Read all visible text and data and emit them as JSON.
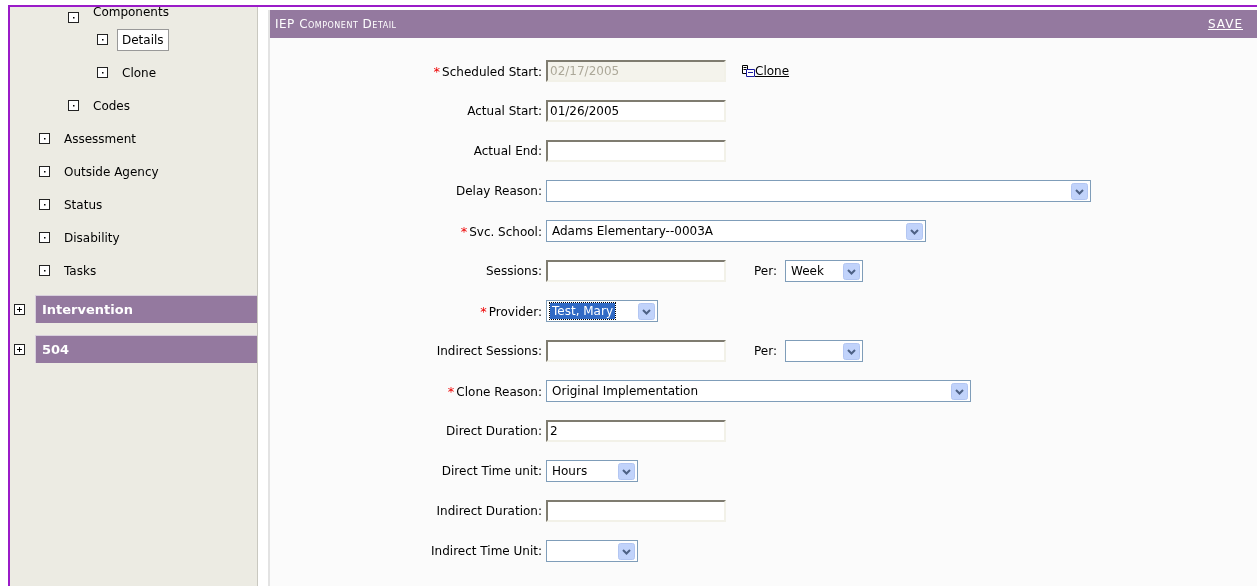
{
  "sidebar": {
    "items": [
      {
        "children": [
          {
            "label": "Components",
            "children": [
              {
                "label": "Details",
                "selected": true
              },
              {
                "label": "Clone",
                "selected": false
              }
            ]
          },
          {
            "label": "Codes",
            "selected": false
          }
        ]
      },
      {
        "label": "Assessment",
        "selected": false
      },
      {
        "label": "Outside Agency",
        "selected": false
      },
      {
        "label": "Status",
        "selected": false
      },
      {
        "label": "Disability",
        "selected": false
      },
      {
        "label": "Tasks",
        "selected": false
      }
    ],
    "sections": [
      {
        "label": "Intervention",
        "expanded": false
      },
      {
        "label": "504",
        "expanded": false
      }
    ]
  },
  "panel": {
    "title": "IEP Component Detail",
    "action": "SAVE",
    "fields": [
      {
        "kind": "text",
        "required_mark": "*",
        "label": "Scheduled Start:",
        "value": "02/17/2005",
        "disabled": true,
        "link": "Clone"
      },
      {
        "kind": "text",
        "label": "Actual Start:",
        "value": "01/26/2005",
        "disabled": false
      },
      {
        "kind": "text",
        "label": "Actual End:",
        "disabled": false
      },
      {
        "kind": "select",
        "label": "Delay Reason:",
        "selected": false
      },
      {
        "kind": "select",
        "required_mark": "*",
        "label": "Svc. School:",
        "value": "Adams Elementary--0003A",
        "selected": false
      },
      {
        "kind": "text",
        "label": "Sessions:",
        "disabled": false,
        "per": {
          "label": "Per:",
          "value": "Week"
        }
      },
      {
        "kind": "select",
        "required_mark": "*",
        "label": "Provider:",
        "value": "Test, Mary",
        "selected": true
      },
      {
        "kind": "text",
        "label": "Indirect Sessions:",
        "disabled": false,
        "per": {
          "label": "Per:"
        }
      },
      {
        "kind": "select",
        "required_mark": "*",
        "label": "Clone Reason:",
        "value": "Original Implementation",
        "selected": false
      },
      {
        "kind": "text",
        "label": "Direct Duration:",
        "value": "2",
        "disabled": false
      },
      {
        "kind": "select",
        "label": "Direct Time unit:",
        "value": "Hours",
        "selected": false
      },
      {
        "kind": "text",
        "label": "Indirect Duration:",
        "disabled": false
      },
      {
        "kind": "select",
        "label": "Indirect Time Unit:",
        "selected": false
      }
    ]
  }
}
